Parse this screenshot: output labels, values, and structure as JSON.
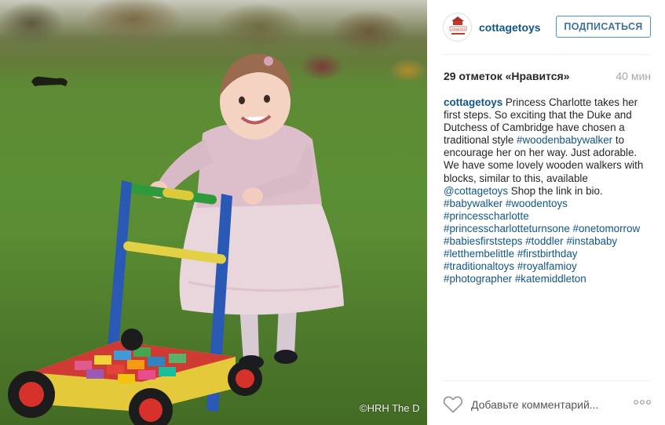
{
  "photo": {
    "watermark": "©HRH The D"
  },
  "post": {
    "account": {
      "username": "cottagetoys",
      "avatar_text": "cottage toys"
    },
    "follow_label": "ПОДПИСАТЬСЯ",
    "likes": "29 отметок «Нравится»",
    "time_ago": "40 мин",
    "caption": {
      "author": "cottagetoys",
      "line1_text": " Princess Charlotte takes her",
      "line2": "first steps. So exciting that the Duke and",
      "line3": "Dutchess of Cambridge have chosen a",
      "line4_text": "traditional style ",
      "line4_tag": "#woodenbabywalker",
      "line4_after": " to",
      "line5": "encourage her on her way. Just adorable.",
      "line6": "We have some lovely wooden walkers with",
      "line7": "blocks, similar to this, available",
      "line8_mention": "@cottagetoys",
      "line8_text": " Shop the link in bio.",
      "tags_line9": [
        "#babywalker",
        "#woodentoys"
      ],
      "tags_line10": [
        "#princesscharlotte"
      ],
      "tags_line11": [
        "#princesscharlotteturnsone",
        "#onetomorrow"
      ],
      "tags_line12": [
        "#babiesfirststeps",
        "#toddler",
        "#instababy"
      ],
      "tags_line13": [
        "#letthembelittle",
        "#firstbirthday"
      ],
      "tags_line14": [
        "#traditionaltoys",
        "#royalfamioy"
      ],
      "tags_line15": [
        "#photographer",
        "#katemiddleton"
      ]
    },
    "comment_placeholder": "Добавьте комментарий...",
    "icons": {
      "like": "heart-outline-icon",
      "more": "three-dots-icon"
    },
    "colors": {
      "link": "#125688",
      "follow_border": "#4a90c9",
      "muted": "#a5a7aa"
    }
  }
}
